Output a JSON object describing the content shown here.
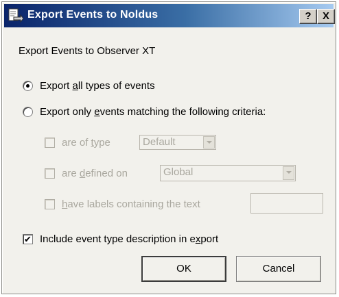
{
  "window": {
    "title": "Export Events to Noldus",
    "help_label": "?",
    "close_label": "X"
  },
  "header_text": "Export Events to Observer XT",
  "options": {
    "export_all": {
      "pre": "Export ",
      "mn": "a",
      "post": "ll types of events",
      "selected": true
    },
    "export_matching": {
      "pre": "Export only ",
      "mn": "e",
      "post": "vents matching the following criteria:",
      "selected": false
    }
  },
  "criteria": {
    "type": {
      "pre": "are of ",
      "mn": "t",
      "post": "ype",
      "checked": false,
      "enabled": false,
      "value": "Default"
    },
    "defined": {
      "pre": "are ",
      "mn": "d",
      "post": "efined on",
      "checked": false,
      "enabled": false,
      "value": "Global"
    },
    "labels": {
      "pre": "",
      "mn": "h",
      "post": "ave labels containing the text",
      "checked": false,
      "enabled": false,
      "value": ""
    }
  },
  "include_desc": {
    "pre": "Include event type description in e",
    "mn": "x",
    "post": "port",
    "checked": true,
    "check_glyph": "✔"
  },
  "buttons": {
    "ok": "OK",
    "cancel": "Cancel"
  }
}
